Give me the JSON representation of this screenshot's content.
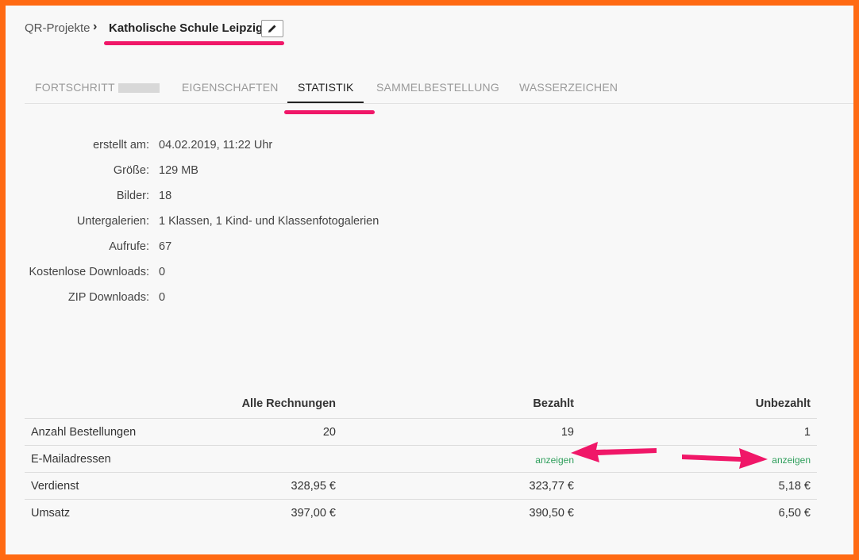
{
  "breadcrumb": {
    "root": "QR-Projekte",
    "separator": "›",
    "current": "Katholische Schule Leipzig",
    "edit_icon": "pencil-icon"
  },
  "tabs": [
    {
      "label": "FORTSCHRITT",
      "active": false
    },
    {
      "label": "EIGENSCHAFTEN",
      "active": false
    },
    {
      "label": "STATISTIK",
      "active": true
    },
    {
      "label": "SAMMELBESTELLUNG",
      "active": false
    },
    {
      "label": "WASSERZEICHEN",
      "active": false
    }
  ],
  "info": [
    {
      "label": "erstellt am:",
      "value": "04.02.2019, 11:22 Uhr"
    },
    {
      "label": "Größe:",
      "value": "129 MB"
    },
    {
      "label": "Bilder:",
      "value": "18"
    },
    {
      "label": "Untergalerien:",
      "value": "1 Klassen, 1 Kind- und Klassenfotogalerien"
    },
    {
      "label": "Aufrufe:",
      "value": "67"
    },
    {
      "label": "Kostenlose Downloads:",
      "value": "0"
    },
    {
      "label": "ZIP Downloads:",
      "value": "0"
    }
  ],
  "table": {
    "headers": [
      "",
      "Alle Rechnungen",
      "Bezahlt",
      "Unbezahlt"
    ],
    "rows": [
      {
        "label": "Anzahl Bestellungen",
        "all": "20",
        "paid": "19",
        "unpaid": "1"
      },
      {
        "label": "E-Mailadressen",
        "all": "",
        "paid": "anzeigen",
        "unpaid": "anzeigen"
      },
      {
        "label": "Verdienst",
        "all": "328,95 €",
        "paid": "323,77 €",
        "unpaid": "5,18 €"
      },
      {
        "label": "Umsatz",
        "all": "397,00 €",
        "paid": "390,50 €",
        "unpaid": "6,50 €"
      }
    ]
  },
  "colors": {
    "frame_border": "#ff6a13",
    "highlight": "#f01768",
    "link": "#2e9e5b",
    "background": "#f8f8f8"
  }
}
